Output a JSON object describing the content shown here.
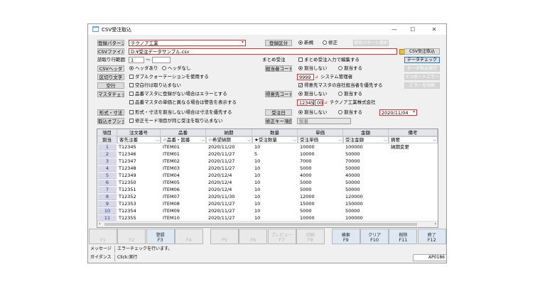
{
  "window": {
    "title": "CSV受注取込",
    "min": "—",
    "max": "☐",
    "close": "✕"
  },
  "pattern": {
    "label": "登録パターン",
    "value": "テクノア工業"
  },
  "file": {
    "label": "CSVファイル",
    "value": "D:¥受注データサンプル.csv"
  },
  "range": {
    "label": "読取り行範囲",
    "from": "1",
    "sep": "～",
    "to": ""
  },
  "header_check": {
    "label": "CSVヘッダ",
    "opt1": "ヘッダあり",
    "opt2": "ヘッダなし"
  },
  "delimiter": {
    "label": "区切り文字",
    "text": "ダブルクォーテーションを使用する"
  },
  "blank_row": {
    "label": "空行",
    "text": "空白行は取り込まない"
  },
  "master_check": {
    "label": "マスタチェック",
    "line1": "品番マスタに登録がない場合はエラーとする",
    "line2": "品番マスタの単価と異なる場合は警告を表示する"
  },
  "format": {
    "label": "形式・寸法",
    "text": "形式・寸法を割当しない場合は寸法を優先する"
  },
  "import_options": {
    "label": "取込オプション",
    "text": "修正モード項目が同じ受注を取り込まない"
  },
  "reg_type": {
    "label": "登録区分",
    "opt1": "新規",
    "opt2": "修正"
  },
  "select_button": "登録パターン選択",
  "bulk": {
    "label": "まとめ受注",
    "text": "まとめ受注入力で編集する"
  },
  "tanto": {
    "label": "担当者コード",
    "opt1": "割当しない",
    "opt2": "割当する",
    "code": "9999",
    "name": "システム管理者",
    "line2": "得意先マスタの自社担当者を優先する"
  },
  "customer": {
    "label": "得意先コード",
    "opt1": "割当しない",
    "opt2": "割当する",
    "code": "12345",
    "sub": "00",
    "name": "テクノア工業株式会社"
  },
  "order_date": {
    "label": "受注日",
    "opt1": "割当しない",
    "opt2": "割当する",
    "date": "2020/11/04"
  },
  "mod_item": {
    "label": "修正キー項目",
    "value": "製番"
  },
  "side_buttons": [
    "CSV受注取込",
    "データチェック",
    "データ取込実行",
    "インポートエラー確認",
    "エラーを印刷"
  ],
  "grid": {
    "headers1": [
      "項目",
      "注文番号",
      "品番",
      "納期",
      "数量",
      "単価",
      "金額",
      "備考"
    ],
    "headers2": [
      "割当",
      "客先注番",
      "☆品番・図番",
      "☆希望納期",
      "★受注数量",
      "受注単価",
      "受注金額",
      "摘要"
    ],
    "rows": [
      {
        "n": "1",
        "order": "T12345",
        "item": "ITEM01",
        "date": "2020/11/20",
        "qty": "10",
        "price": "10000",
        "amount": "100000",
        "note": "納期変更"
      },
      {
        "n": "2",
        "order": "T12346",
        "item": "ITEM01",
        "date": "2020/11/27",
        "qty": "5",
        "price": "10000",
        "amount": "50000",
        "note": ""
      },
      {
        "n": "3",
        "order": "T12347",
        "item": "ITEM02",
        "date": "2020/11/27",
        "qty": "10",
        "price": "7000",
        "amount": "70000",
        "note": ""
      },
      {
        "n": "4",
        "order": "T12348",
        "item": "ITEM03",
        "date": "2020/11/27",
        "qty": "10",
        "price": "5000",
        "amount": "50000",
        "note": ""
      },
      {
        "n": "5",
        "order": "T12349",
        "item": "ITEM04",
        "date": "2020/12/4",
        "qty": "10",
        "price": "4000",
        "amount": "40000",
        "note": ""
      },
      {
        "n": "6",
        "order": "T12350",
        "item": "ITEM05",
        "date": "2020/12/4",
        "qty": "10",
        "price": "5000",
        "amount": "50000",
        "note": ""
      },
      {
        "n": "7",
        "order": "T12351",
        "item": "ITEM06",
        "date": "2020/12/4",
        "qty": "10",
        "price": "5000",
        "amount": "50000",
        "note": ""
      },
      {
        "n": "8",
        "order": "T12352",
        "item": "ITEM07",
        "date": "2020/11/30",
        "qty": "10",
        "price": "12000",
        "amount": "120000",
        "note": ""
      },
      {
        "n": "9",
        "order": "T12353",
        "item": "ITEM08",
        "date": "2020/11/27",
        "qty": "10",
        "price": "15000",
        "amount": "150000",
        "note": ""
      },
      {
        "n": "10",
        "order": "T12354",
        "item": "ITEM09",
        "date": "2020/11/27",
        "qty": "10",
        "price": "5000",
        "amount": "50000",
        "note": ""
      },
      {
        "n": "11",
        "order": "T12355",
        "item": "ITEM10",
        "date": "2020/11/27",
        "qty": "10",
        "price": "10000",
        "amount": "100000",
        "note": ""
      }
    ]
  },
  "fkeys": [
    {
      "l1": "",
      "l2": "F1"
    },
    {
      "l1": "",
      "l2": "F2"
    },
    {
      "l1": "登録",
      "l2": "F3"
    },
    {
      "l1": "",
      "l2": "F4"
    },
    {
      "l1": "",
      "l2": "F5"
    },
    {
      "l1": "",
      "l2": "F6"
    },
    {
      "l1": "プレビュー",
      "l2": "F7"
    },
    {
      "l1": "印刷",
      "l2": "F8"
    },
    {
      "l1": "検索",
      "l2": "F9"
    },
    {
      "l1": "クリア",
      "l2": "F10"
    },
    {
      "l1": "削除",
      "l2": "F11"
    },
    {
      "l1": "終了",
      "l2": "F12"
    }
  ],
  "status": {
    "msg_label": "メッセージ",
    "msg": "エラーチェックを行います。",
    "guide_label": "ガイダンス",
    "guide": "Click:実行",
    "screen_id": "AP0186"
  },
  "colors": {
    "accent_red": "#d33333",
    "row_header": "#1a3a8a"
  }
}
